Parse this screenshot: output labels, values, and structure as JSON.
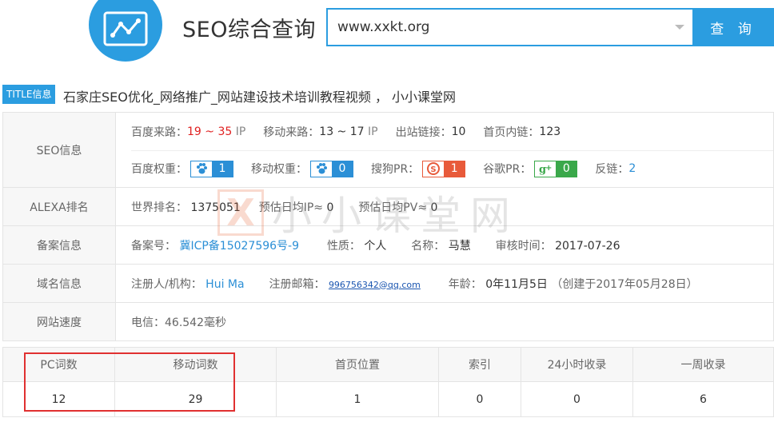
{
  "header": {
    "site_title": "SEO综合查询",
    "search_value": "www.xxkt.org",
    "search_button": "查 询"
  },
  "title_info": {
    "badge": "TITLE信息",
    "text": "石家庄SEO优化_网络推广_网站建设技术培训教程视频 ， 小小课堂网"
  },
  "seo": {
    "label": "SEO信息",
    "baidu_traffic_label": "百度来路：",
    "baidu_traffic_value": "19 ~ 35",
    "baidu_traffic_unit": "IP",
    "mobile_traffic_label": "移动来路：",
    "mobile_traffic_value": "13 ~ 17",
    "mobile_traffic_unit": "IP",
    "outbound_label": "出站链接：",
    "outbound_value": "10",
    "internal_label": "首页内链：",
    "internal_value": "123",
    "baidu_weight_label": "百度权重：",
    "baidu_weight_value": "1",
    "mobile_weight_label": "移动权重：",
    "mobile_weight_value": "0",
    "sogou_pr_label": "搜狗PR：",
    "sogou_pr_value": "1",
    "google_pr_label": "谷歌PR：",
    "google_pr_value": "0",
    "backlinks_label": "反链：",
    "backlinks_value": "2"
  },
  "alexa": {
    "label": "ALEXA排名",
    "world_rank_label": "世界排名：",
    "world_rank_value": "1375051",
    "est_ip_label": "预估日均IP≈",
    "est_ip_value": "0",
    "est_pv_label": "预估日均PV≈",
    "est_pv_value": "0"
  },
  "icp": {
    "label": "备案信息",
    "number_label": "备案号：",
    "number_value": "冀ICP备15027596号-9",
    "nature_label": "性质：",
    "nature_value": "个人",
    "name_label": "名称：",
    "name_value": "马慧",
    "audit_label": "审核时间：",
    "audit_value": "2017-07-26"
  },
  "domain": {
    "label": "域名信息",
    "registrant_label": "注册人/机构：",
    "registrant_value": "Hui Ma",
    "email_label": "注册邮箱：",
    "email_value": "996756342@qq.com",
    "age_label": "年龄：",
    "age_value": "0年11月5日",
    "created_text": "（创建于2017年05月28日）"
  },
  "speed": {
    "label": "网站速度",
    "value": "电信：46.542毫秒"
  },
  "keywords": {
    "headers": [
      "PC词数",
      "移动词数",
      "首页位置",
      "索引",
      "24小时收录",
      "一周收录"
    ],
    "values": [
      "12",
      "29",
      "1",
      "0",
      "0",
      "6"
    ]
  },
  "watermark": {
    "text": "小小课堂网"
  },
  "colors": {
    "accent": "#2b9de0",
    "danger": "#e02020",
    "sogou": "#e85a3a",
    "google": "#3aa84a"
  }
}
